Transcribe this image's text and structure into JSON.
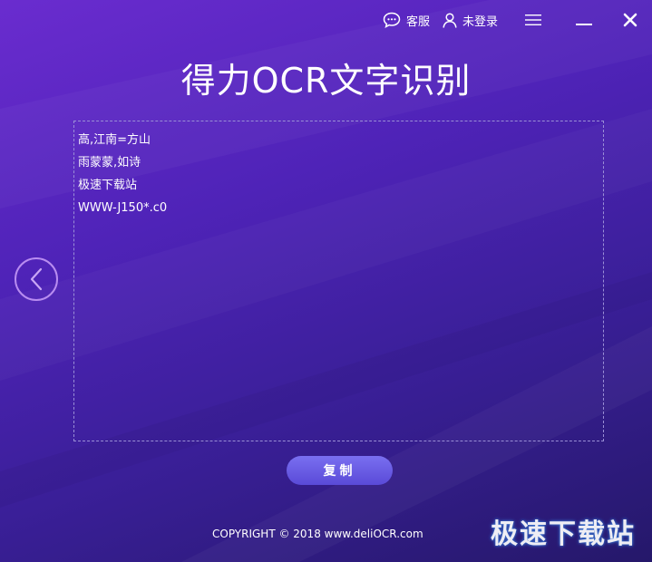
{
  "topbar": {
    "service_label": "客服",
    "login_label": "未登录",
    "menu_icon": "hamburger-menu-icon",
    "minimize_icon": "minimize-icon",
    "close_icon": "close-icon"
  },
  "app": {
    "title": "得力OCR文字识别"
  },
  "result": {
    "lines": [
      "高,江南=方山",
      "雨蒙蒙,如诗",
      "极速下载站",
      "WWW-J150*.c0"
    ]
  },
  "navigation": {
    "prev_icon": "chevron-left-icon"
  },
  "actions": {
    "copy_label": "复制"
  },
  "footer": {
    "copyright": "COPYRIGHT © 2018  www.deliOCR.com"
  },
  "watermark": {
    "text": "极速下载站"
  },
  "colors": {
    "background_top": "#6a2ccf",
    "background_bottom": "#25186a",
    "accent_button": "#6a5ce6",
    "dashed_border": "#9a8fd6",
    "nav_circle": "#b88cf0"
  }
}
